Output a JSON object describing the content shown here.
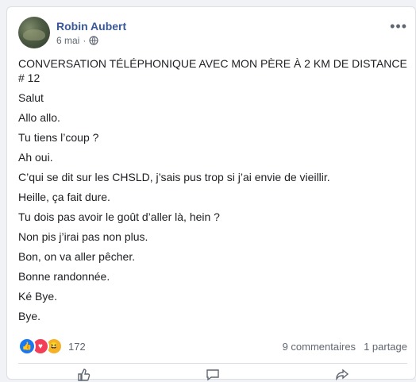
{
  "post": {
    "author": "Robin Aubert",
    "date": "6 mai",
    "privacy_icon": "globe-icon",
    "lines": [
      "CONVERSATION TÉLÉPHONIQUE AVEC MON PÈRE À 2 KM DE DISTANCE # 12",
      "Salut",
      "Allo allo.",
      "Tu tiens l’coup ?",
      "Ah oui.",
      "C’qui se dit sur les CHSLD, j’sais pus trop si j’ai envie de vieillir.",
      "Heille, ça fait dure.",
      "Tu dois pas avoir le goût d’aller là, hein ?",
      "Non pis j’irai pas non plus.",
      "Bon, on va aller pêcher.",
      "Bonne randonnée.",
      "Ké Bye.",
      "Bye."
    ]
  },
  "stats": {
    "reactions": "172",
    "comments": "9 commentaires",
    "shares": "1 partage"
  },
  "colors": {
    "author": "#385898",
    "like": "#1877f2",
    "love": "#f33e58",
    "haha": "#f7b125"
  }
}
